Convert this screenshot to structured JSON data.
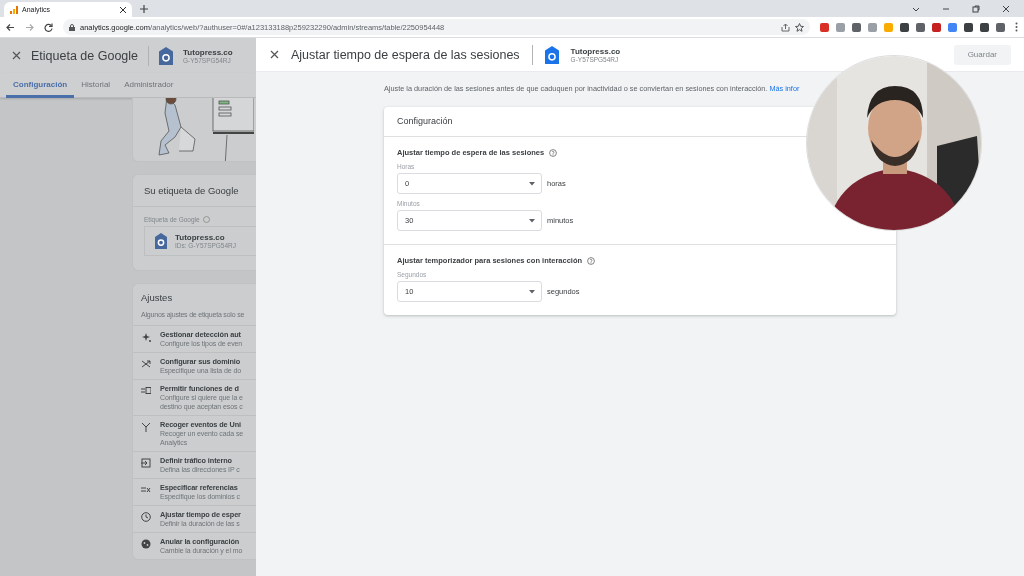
{
  "browser": {
    "tab_title": "Analytics",
    "url_host": "analytics.google.com",
    "url_path": "/analytics/web/?authuser=0#/a123133188p259232290/admin/streams/table/2250954448"
  },
  "left_panel": {
    "title": "Etiqueta de Google",
    "tag_name": "Tutopress.co",
    "tag_id": "G-Y57SPG54RJ",
    "tabs": [
      {
        "label": "Configuración",
        "selected": true
      },
      {
        "label": "Historial",
        "selected": false
      },
      {
        "label": "Administrador",
        "selected": false
      }
    ],
    "tag_card": {
      "title": "Su etiqueta de Google",
      "label": "Etiqueta de Google",
      "tag_name": "Tutopress.co",
      "tag_ids": "IDs: G-Y57SPG54RJ"
    },
    "settings": {
      "title": "Ajustes",
      "subtitle": "Algunos ajustes de etiqueta solo se",
      "items": [
        {
          "kind": "sparkle",
          "title": "Gestionar detección aut",
          "description": [
            "Configure los tipos de even"
          ]
        },
        {
          "kind": "domains",
          "title": "Configurar sus dominio",
          "description": [
            "Especifique una lista de do"
          ]
        },
        {
          "kind": "features",
          "title": "Permitir funciones de d",
          "description": [
            "Configure si quiere que la e",
            "destino que aceptan esos c"
          ]
        },
        {
          "kind": "merge",
          "title": "Recoger eventos de Uni",
          "description": [
            "Recoger un evento cada se",
            "Analytics"
          ]
        },
        {
          "kind": "login",
          "title": "Definir tráfico interno",
          "description": [
            "Defina las direcciones IP c"
          ]
        },
        {
          "kind": "filter",
          "title": "Especificar referencias",
          "description": [
            "Especifique los dominios c"
          ]
        },
        {
          "kind": "clock",
          "title": "Ajustar tiempo de esper",
          "description": [
            "Definir la duración de las s"
          ]
        },
        {
          "kind": "cookie",
          "title": "Anular la configuración",
          "description": [
            "Cambie la duración y el mo"
          ]
        }
      ]
    }
  },
  "drawer": {
    "title": "Ajustar tiempo de espera de las sesiones",
    "tag_name": "Tutopress.co",
    "tag_id": "G-Y57SPG54RJ",
    "save_button": {
      "label": "Guardar",
      "disabled": true
    },
    "intro": "Ajuste la duración de las sesiones antes de que caduquen por inactividad o se conviertan en sesiones con interacción.",
    "link": "Más infor",
    "card": {
      "title": "Configuración",
      "sections": [
        {
          "title": "Ajustar tiempo de espera de las sesiones",
          "fields": [
            {
              "label": "Horas",
              "value": "0",
              "unit": "horas"
            },
            {
              "label": "Minutos",
              "value": "30",
              "unit": "minutos"
            }
          ]
        },
        {
          "title": "Ajustar temporizador para sesiones con interacción",
          "fields": [
            {
              "label": "Segundos",
              "value": "10",
              "unit": "segundos"
            }
          ]
        }
      ]
    }
  }
}
